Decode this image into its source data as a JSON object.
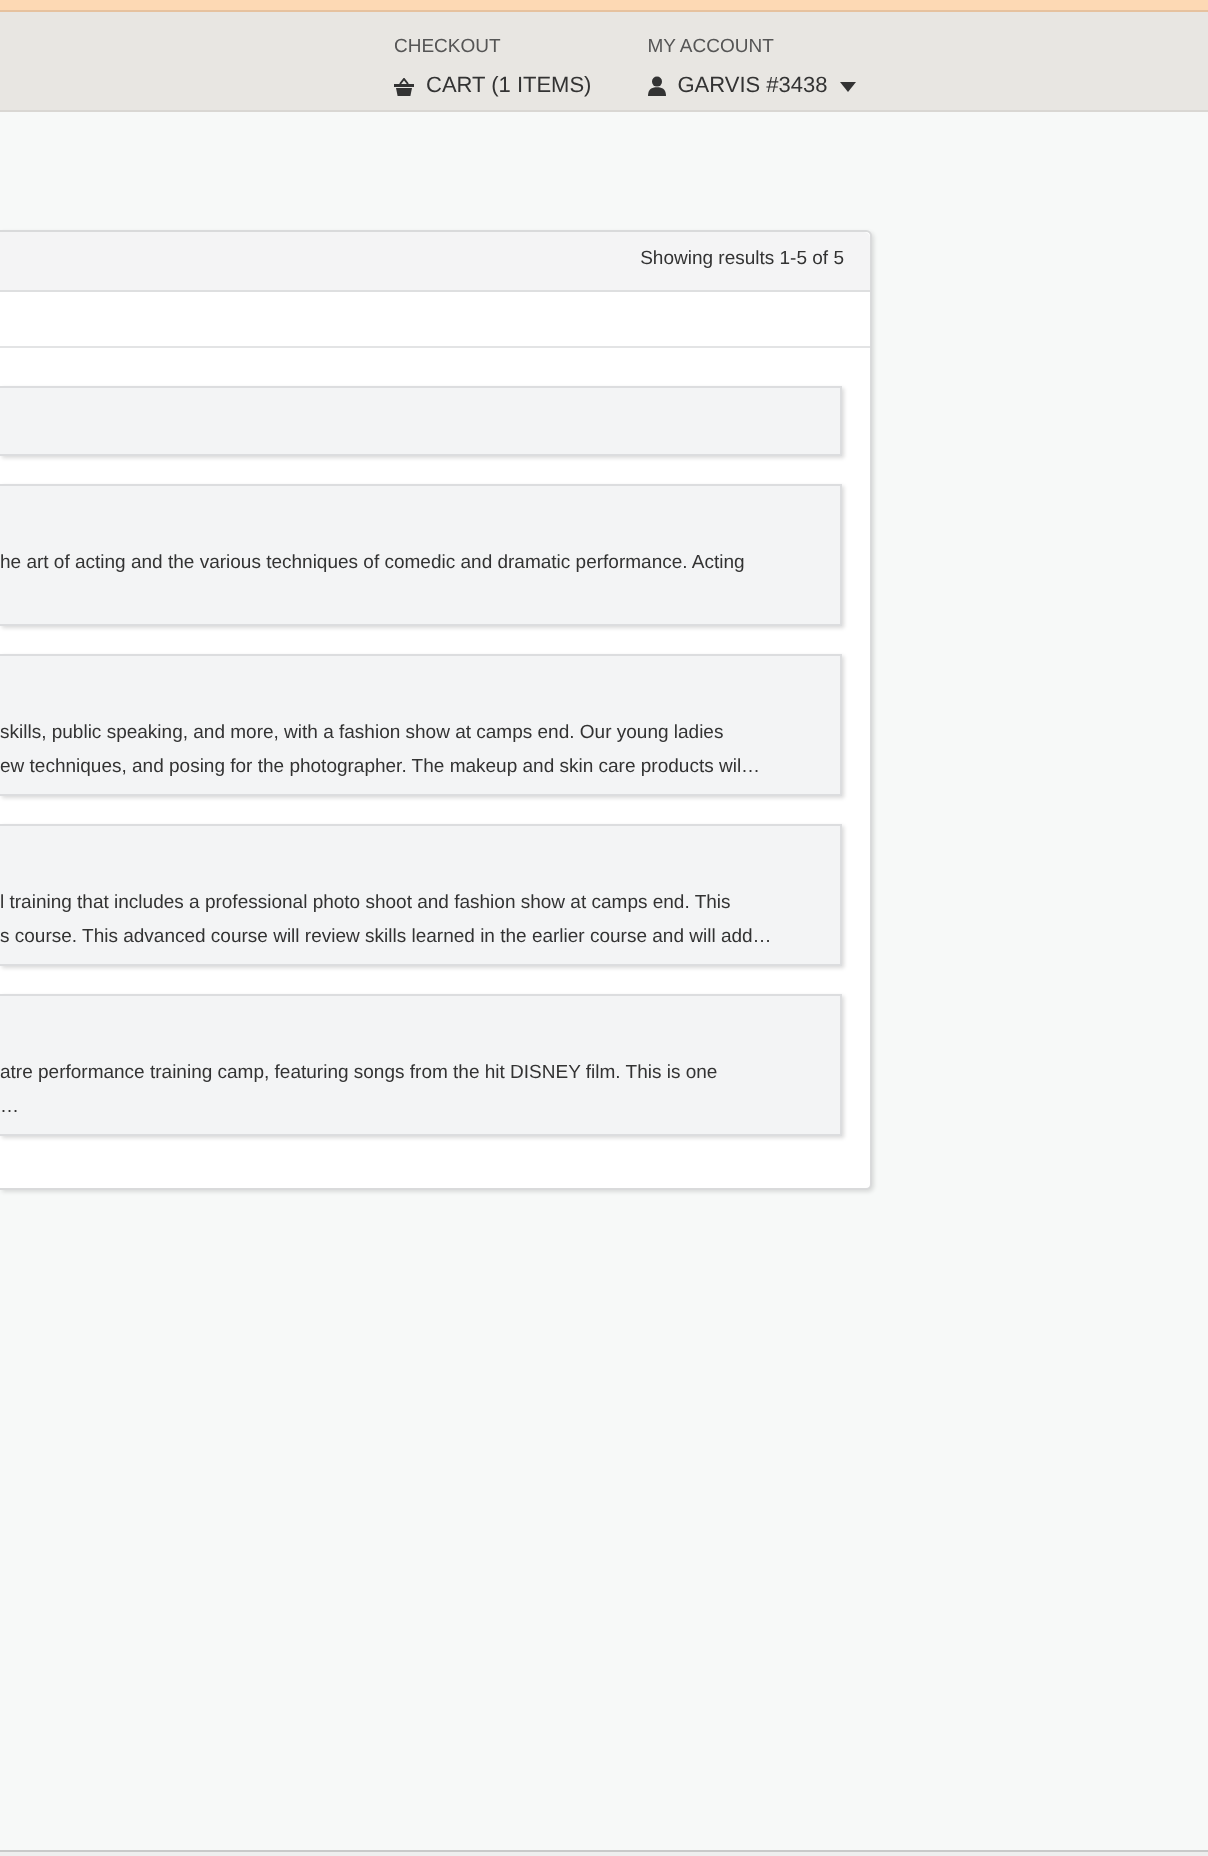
{
  "header": {
    "menus": [
      {
        "kind": "cart",
        "label": "CHECKOUT",
        "link": "CART (1 ITEMS)",
        "dropdown": false
      },
      {
        "kind": "account",
        "label": "MY ACCOUNT",
        "link": "GARVIS #3438",
        "dropdown": true
      }
    ]
  },
  "results": {
    "summary": "Showing results 1-5 of 5",
    "cards": [
      {
        "kind": "bar"
      },
      {
        "kind": "course",
        "lines": [
          "he art of acting and the various techniques of comedic and dramatic performance. Acting"
        ]
      },
      {
        "kind": "course",
        "lines": [
          "skills, public speaking, and more, with a fashion show at camps end. Our young ladies",
          "ew techniques, and posing for the photographer. The makeup and skin care products wil…"
        ]
      },
      {
        "kind": "course",
        "lines": [
          "l training that includes a professional photo shoot and fashion show at camps end. This",
          "s course. This advanced course will review skills learned in the earlier course and will add…"
        ]
      },
      {
        "kind": "course",
        "lines": [
          "atre performance training camp, featuring songs from the hit DISNEY film. This is one",
          "…"
        ]
      }
    ]
  }
}
